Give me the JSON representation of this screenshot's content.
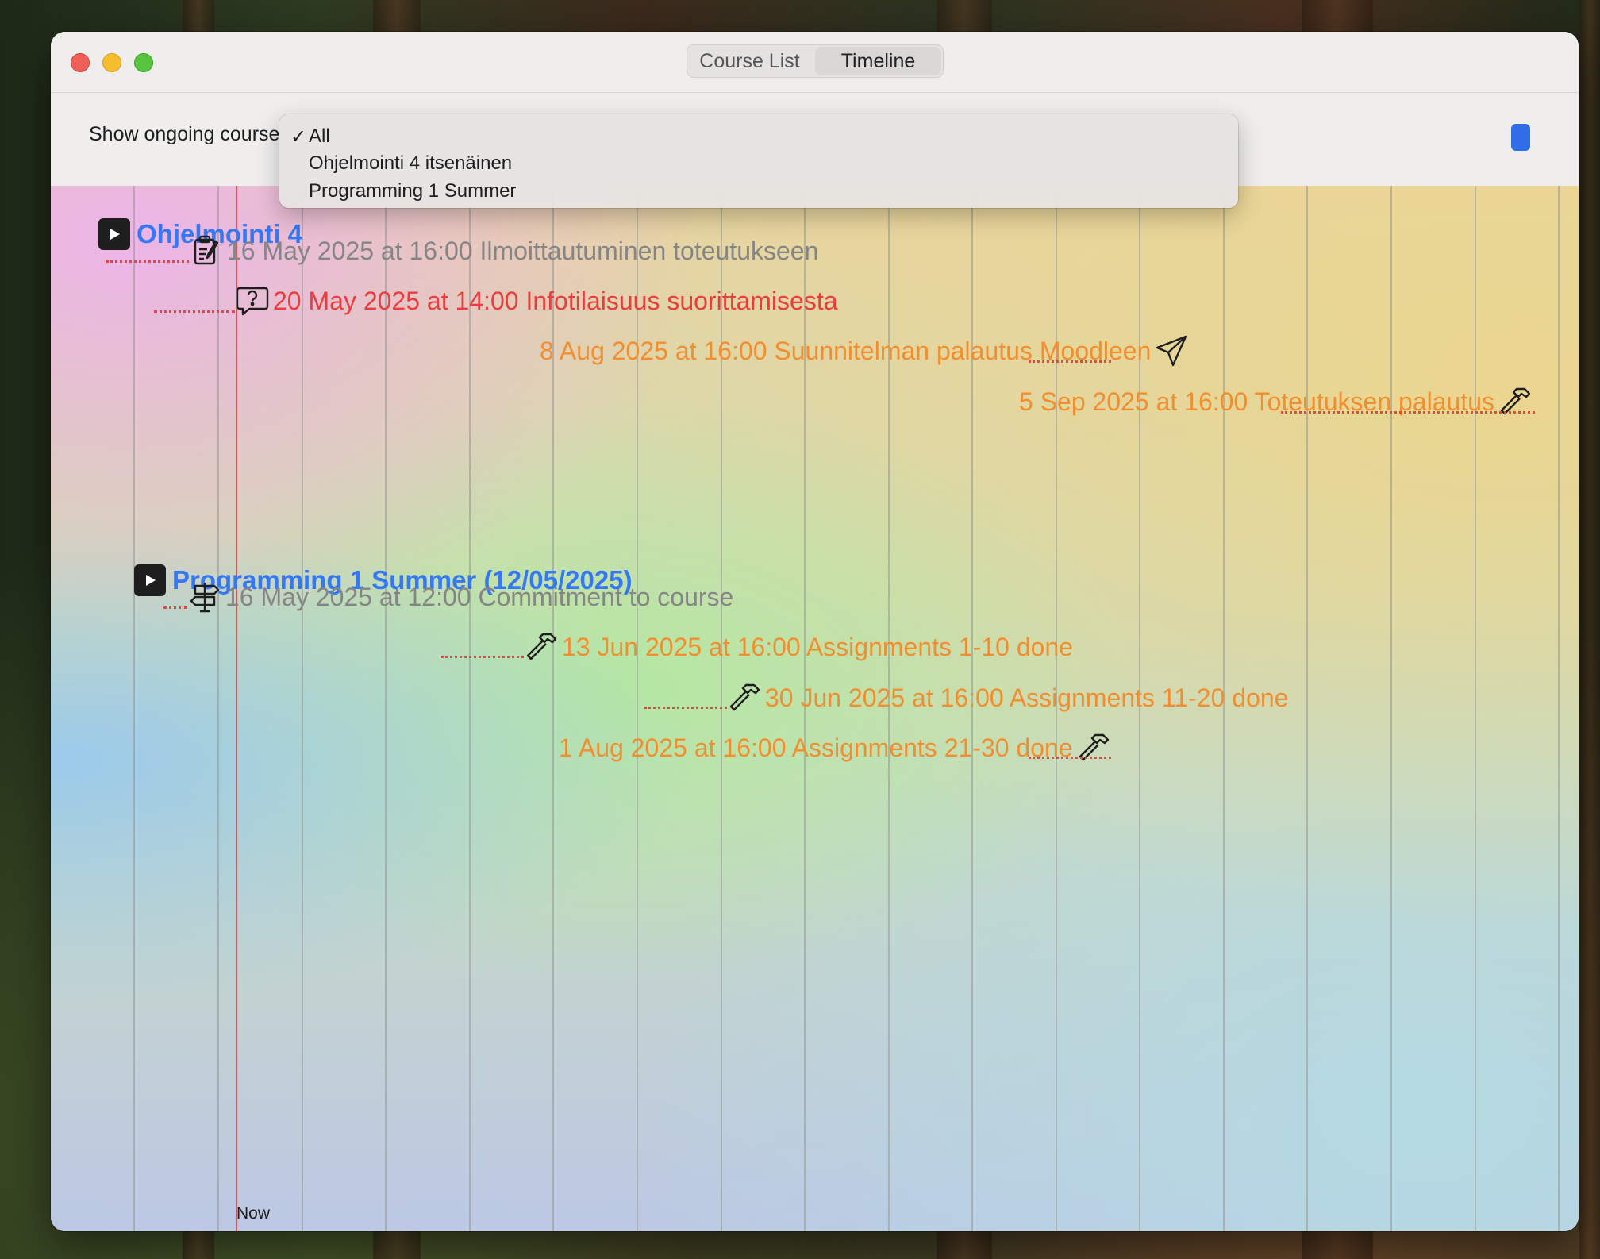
{
  "window": {
    "tabs": [
      {
        "label": "Course List",
        "active": false
      },
      {
        "label": "Timeline",
        "active": true
      }
    ]
  },
  "toolbar": {
    "filter_label": "Show ongoing course"
  },
  "dropdown": {
    "items": [
      {
        "label": "All",
        "checked": true
      },
      {
        "label": "Ohjelmointi 4 itsenäinen",
        "checked": false
      },
      {
        "label": "Programming 1 Summer",
        "checked": false
      }
    ]
  },
  "timeline": {
    "now_label": "Now",
    "courses": [
      {
        "title": "Ohjelmointi 4",
        "events": [
          {
            "text": "16 May 2025 at 16:00 Ilmoittautuminen toteutukseen",
            "icon": "clipboard-edit-icon",
            "color": "#858585"
          },
          {
            "text": "20 May 2025 at 14:00 Infotilaisuus suorittamisesta",
            "icon": "question-bubble-icon",
            "color": "#ea3d3d"
          },
          {
            "text": "8 Aug 2025 at 16:00 Suunnitelman palautus Moodleen",
            "icon": "paper-plane-icon",
            "color": "#f28e2e"
          },
          {
            "text": "5 Sep 2025 at 16:00 Toteutuksen palautus",
            "icon": "hammer-icon",
            "color": "#f28e2e"
          }
        ]
      },
      {
        "title": "Programming 1 Summer (12/05/2025)",
        "events": [
          {
            "text": "16 May 2025 at 12:00 Commitment to course",
            "icon": "signpost-icon",
            "color": "#858585"
          },
          {
            "text": "13 Jun 2025 at 16:00 Assignments 1-10 done",
            "icon": "hammer-icon",
            "color": "#f28e2e"
          },
          {
            "text": "30 Jun 2025 at 16:00 Assignments 11-20 done",
            "icon": "hammer-icon",
            "color": "#f28e2e"
          },
          {
            "text": "1 Aug 2025 at 16:00 Assignments 21-30 done",
            "icon": "hammer-icon",
            "color": "#f28e2e"
          }
        ]
      }
    ]
  },
  "colors": {
    "accent": "#3478f6",
    "now_line": "#ef4b4b",
    "past_event": "#858585",
    "info_event": "#ea3d3d",
    "deadline_event": "#f28e2e"
  }
}
